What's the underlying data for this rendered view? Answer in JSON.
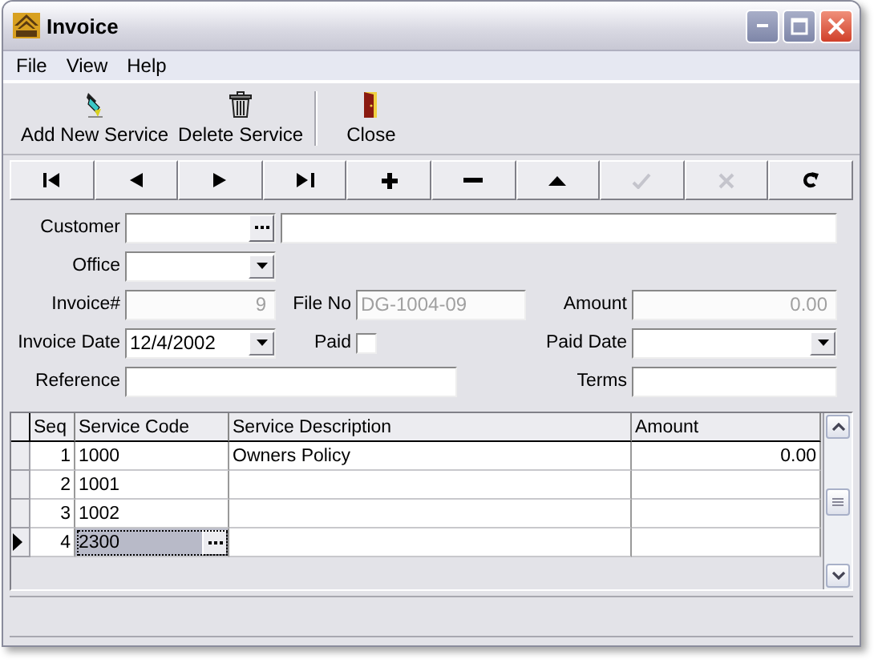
{
  "window": {
    "title": "Invoice"
  },
  "menu": [
    "File",
    "View",
    "Help"
  ],
  "toolbar": [
    {
      "kind": "add",
      "label": "Add New Service"
    },
    {
      "kind": "delete",
      "label": "Delete Service"
    },
    {
      "kind": "close",
      "label": "Close"
    }
  ],
  "navigator": [
    {
      "kind": "first",
      "disabled": false
    },
    {
      "kind": "prior",
      "disabled": false
    },
    {
      "kind": "next",
      "disabled": false
    },
    {
      "kind": "last",
      "disabled": false
    },
    {
      "kind": "insert",
      "disabled": false
    },
    {
      "kind": "delete",
      "disabled": false
    },
    {
      "kind": "edit",
      "disabled": false
    },
    {
      "kind": "post",
      "disabled": true
    },
    {
      "kind": "cancel",
      "disabled": true
    },
    {
      "kind": "refresh",
      "disabled": false
    }
  ],
  "form": {
    "customer": {
      "label": "Customer"
    },
    "office": {
      "label": "Office"
    },
    "invoice_no": {
      "label": "Invoice#",
      "value": "9",
      "disabled": true
    },
    "file_no": {
      "label": "File No",
      "value": "DG-1004-09",
      "disabled": true
    },
    "amount": {
      "label": "Amount",
      "value": "0.00",
      "disabled": true
    },
    "invoice_date": {
      "label": "Invoice Date",
      "value": "12/4/2002"
    },
    "paid": {
      "label": "Paid",
      "checked": false
    },
    "paid_date": {
      "label": "Paid Date"
    },
    "reference": {
      "label": "Reference"
    },
    "terms": {
      "label": "Terms"
    }
  },
  "grid": {
    "columns": [
      "Seq",
      "Service Code",
      "Service Description",
      "Amount"
    ],
    "rows": [
      {
        "seq": "1",
        "code": "1000",
        "description": "Owners Policy",
        "amount": "0.00",
        "selected": false
      },
      {
        "seq": "2",
        "code": "1001",
        "selected": false
      },
      {
        "seq": "3",
        "code": "1002",
        "selected": false
      },
      {
        "seq": "4",
        "code": "2300",
        "selected": true
      }
    ]
  }
}
